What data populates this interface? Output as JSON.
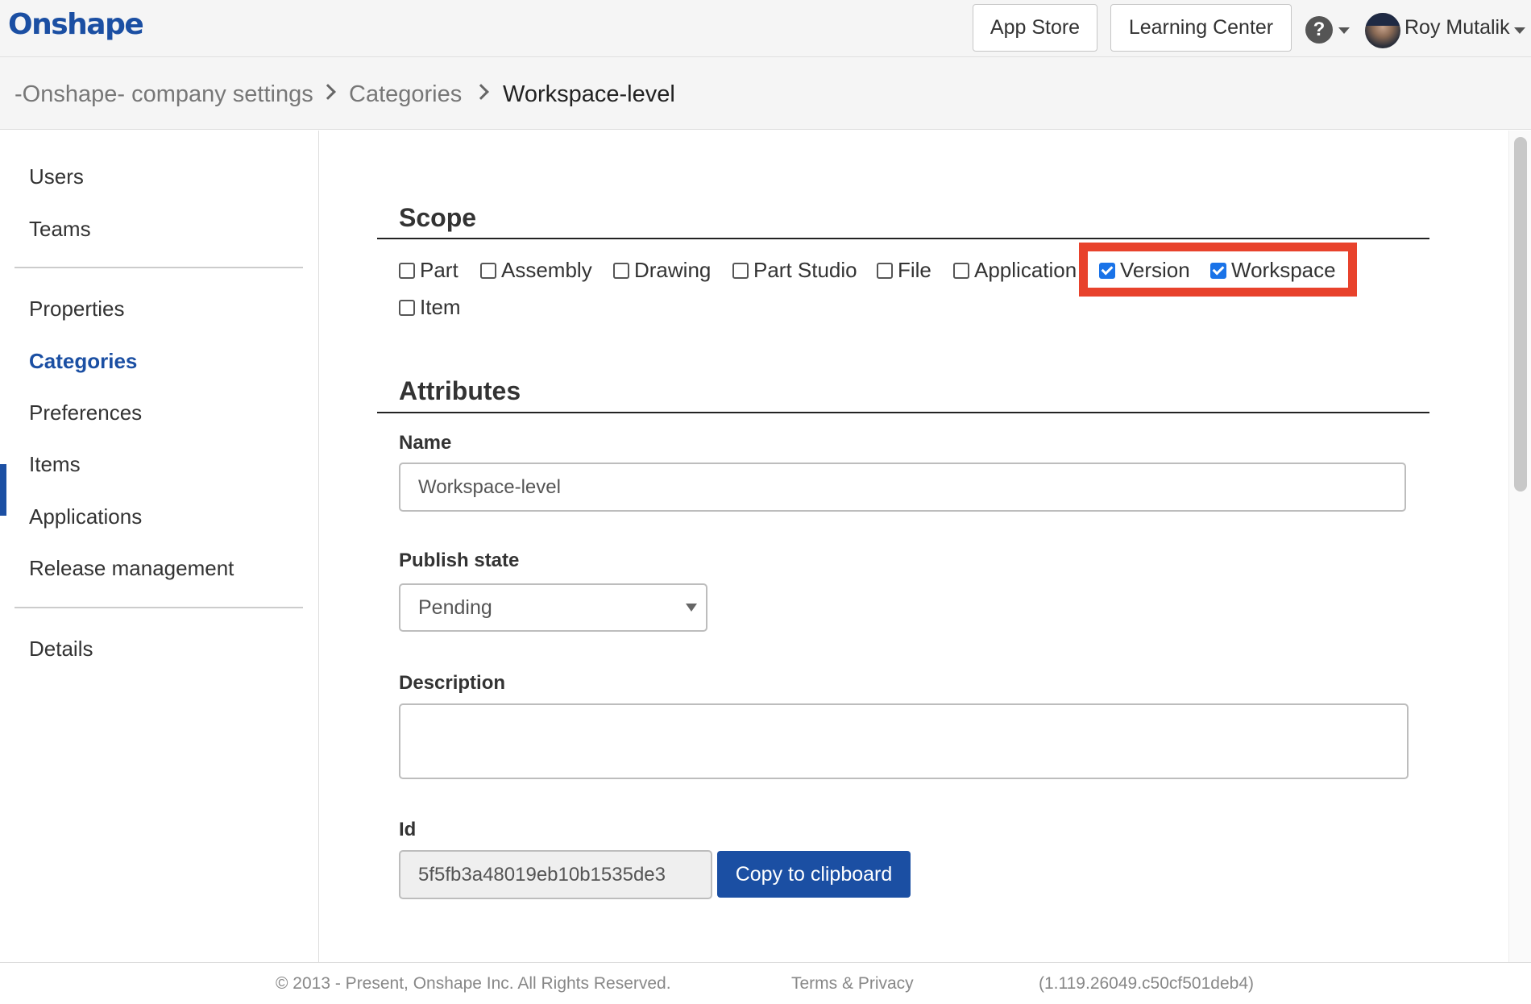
{
  "app": {
    "logo": "Onshape"
  },
  "header": {
    "app_store": "App Store",
    "learning_center": "Learning Center",
    "help_symbol": "?",
    "user_name": "Roy Mutalik"
  },
  "breadcrumb": {
    "items": [
      "-Onshape- company settings",
      "Categories",
      "Workspace-level"
    ]
  },
  "sidebar": {
    "items": [
      "Users",
      "Teams",
      "Properties",
      "Categories",
      "Preferences",
      "Items",
      "Applications",
      "Release management",
      "Details"
    ],
    "active": "Categories"
  },
  "scope": {
    "title": "Scope",
    "options": [
      {
        "label": "Part",
        "checked": false
      },
      {
        "label": "Assembly",
        "checked": false
      },
      {
        "label": "Drawing",
        "checked": false
      },
      {
        "label": "Part Studio",
        "checked": false
      },
      {
        "label": "File",
        "checked": false
      },
      {
        "label": "Application",
        "checked": false
      },
      {
        "label": "Version",
        "checked": true
      },
      {
        "label": "Workspace",
        "checked": true
      },
      {
        "label": "Item",
        "checked": false
      }
    ],
    "highlight_color": "#e8422c"
  },
  "attributes": {
    "title": "Attributes",
    "name_label": "Name",
    "name_value": "Workspace-level",
    "publish_label": "Publish state",
    "publish_value": "Pending",
    "description_label": "Description",
    "description_value": "",
    "id_label": "Id",
    "id_value": "5f5fb3a48019eb10b1535de3",
    "copy_button": "Copy to clipboard"
  },
  "footer": {
    "copyright": "© 2013 - Present, Onshape Inc. All Rights Reserved.",
    "terms": "Terms & Privacy",
    "version": "(1.119.26049.c50cf501deb4)"
  },
  "colors": {
    "brand": "#1b4fa3",
    "checkbox": "#1a73e8"
  }
}
